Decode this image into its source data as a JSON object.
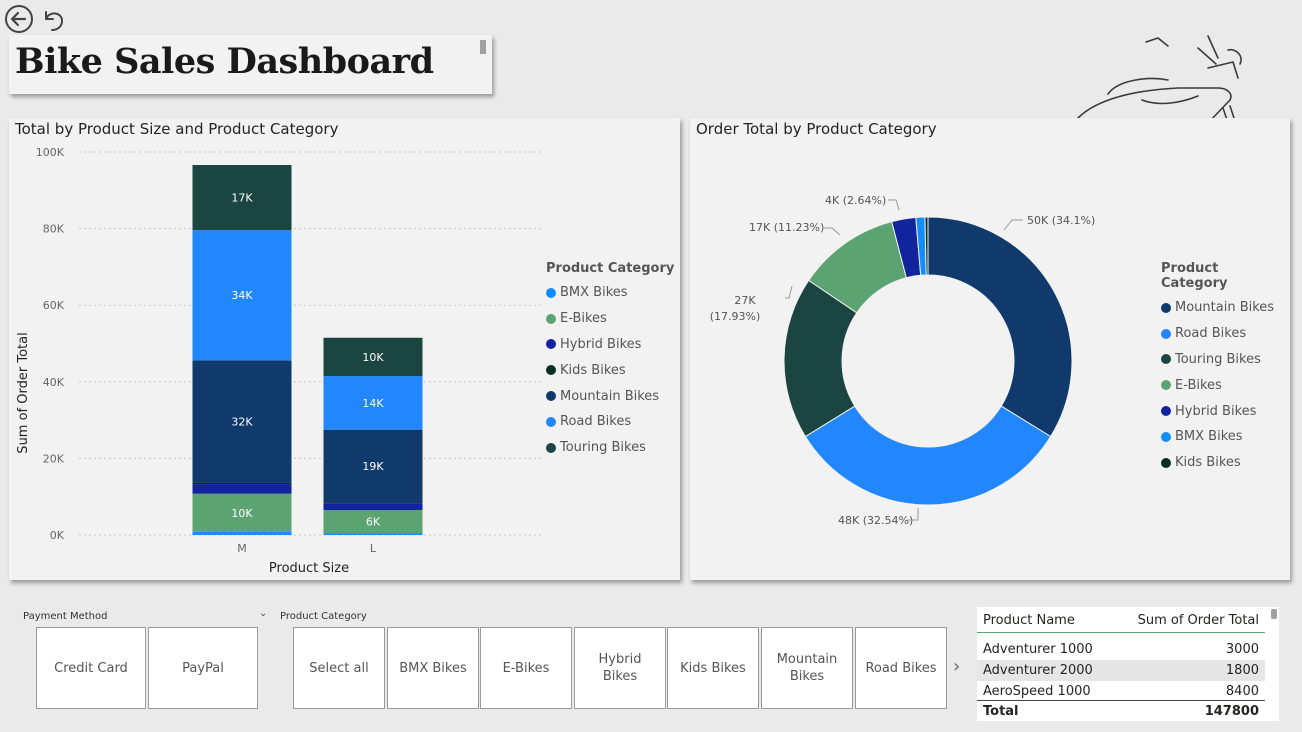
{
  "dashboard": {
    "title": "Bike Sales Dashboard"
  },
  "nav": {
    "back_icon": "back-arrow-icon",
    "undo_icon": "undo-icon"
  },
  "bar_chart": {
    "title": "Total by Product Size and Product Category",
    "xlabel": "Product Size",
    "ylabel": "Sum of Order Total",
    "legend_title": "Product Category",
    "legend": [
      "BMX Bikes",
      "E-Bikes",
      "Hybrid Bikes",
      "Kids Bikes",
      "Mountain Bikes",
      "Road Bikes",
      "Touring Bikes"
    ],
    "yticks": [
      "100K",
      "80K",
      "60K",
      "40K",
      "20K",
      "0K"
    ]
  },
  "donut_chart": {
    "title": "Order Total by Product Category",
    "legend_title": "Product Category",
    "legend": [
      "Mountain Bikes",
      "Road Bikes",
      "Touring Bikes",
      "E-Bikes",
      "Hybrid Bikes",
      "BMX Bikes",
      "Kids Bikes"
    ],
    "labels": {
      "mountain": "50K (34.1%)",
      "road": "48K (32.54%)",
      "touring_a": "27K",
      "touring_b": "(17.93%)",
      "ebikes": "17K (11.23%)",
      "hybrid": "4K (2.64%)"
    }
  },
  "colors": {
    "bmx": "#118DFF",
    "ebikes": "#5BA471",
    "hybrid": "#12239E",
    "kids": "#0B2E22",
    "mountain": "#0F3A6B",
    "road": "#2287FC",
    "touring": "#1B4540"
  },
  "chart_data": [
    {
      "type": "bar",
      "title": "Total by Product Size and Product Category",
      "xlabel": "Product Size",
      "ylabel": "Sum of Order Total",
      "categories": [
        "M",
        "L"
      ],
      "ylim": [
        0,
        100000
      ],
      "series": [
        {
          "name": "BMX Bikes",
          "values": [
            800,
            500
          ]
        },
        {
          "name": "E-Bikes",
          "values": [
            10000,
            6000
          ]
        },
        {
          "name": "Hybrid Bikes",
          "values": [
            2500,
            1800
          ]
        },
        {
          "name": "Kids Bikes",
          "values": [
            300,
            200
          ]
        },
        {
          "name": "Mountain Bikes",
          "values": [
            32000,
            19000
          ]
        },
        {
          "name": "Road Bikes",
          "values": [
            34000,
            14000
          ]
        },
        {
          "name": "Touring Bikes",
          "values": [
            17000,
            10000
          ]
        }
      ],
      "data_labels": {
        "M": {
          "E-Bikes": "10K",
          "Mountain Bikes": "32K",
          "Road Bikes": "34K",
          "Touring Bikes": "17K"
        },
        "L": {
          "E-Bikes": "6K",
          "Mountain Bikes": "19K",
          "Road Bikes": "14K",
          "Touring Bikes": "10K"
        }
      },
      "legend_placement": "right",
      "grid": true
    },
    {
      "type": "pie",
      "title": "Order Total by Product Category",
      "donut": true,
      "slices": [
        {
          "name": "Mountain Bikes",
          "value": 50000,
          "percent": 34.1
        },
        {
          "name": "Road Bikes",
          "value": 48000,
          "percent": 32.54
        },
        {
          "name": "Touring Bikes",
          "value": 27000,
          "percent": 17.93
        },
        {
          "name": "E-Bikes",
          "value": 17000,
          "percent": 11.23
        },
        {
          "name": "Hybrid Bikes",
          "value": 4000,
          "percent": 2.64
        },
        {
          "name": "BMX Bikes",
          "value": 1500,
          "percent": 1.05
        },
        {
          "name": "Kids Bikes",
          "value": 500,
          "percent": 0.34
        }
      ],
      "legend_placement": "right"
    }
  ],
  "payment_slicer": {
    "title": "Payment Method",
    "options": [
      "Credit Card",
      "PayPal"
    ]
  },
  "category_slicer": {
    "title": "Product Category",
    "options": [
      "Select all",
      "BMX Bikes",
      "E-Bikes",
      "Hybrid Bikes",
      "Kids Bikes",
      "Mountain Bikes",
      "Road Bikes"
    ]
  },
  "table": {
    "headers": [
      "Product Name",
      "Sum of Order Total"
    ],
    "rows": [
      [
        "Adventurer 1000",
        "3000"
      ],
      [
        "Adventurer 2000",
        "1800"
      ],
      [
        "AeroSpeed 1000",
        "8400"
      ]
    ],
    "total_label": "Total",
    "total_value": "147800"
  }
}
